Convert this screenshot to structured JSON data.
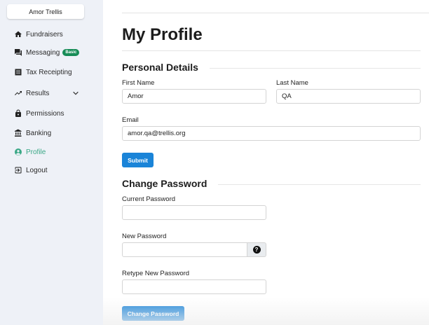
{
  "sidebar": {
    "org_name": "Amor Trellis",
    "items": [
      {
        "label": "Fundraisers",
        "icon": "home-icon"
      },
      {
        "label": "Messaging",
        "icon": "chat-icon",
        "badge": "Basic"
      },
      {
        "label": "Tax Receipting",
        "icon": "receipt-icon"
      },
      {
        "label": "Results",
        "icon": "trending-up-icon"
      },
      {
        "label": "Permissions",
        "icon": "lock-icon"
      },
      {
        "label": "Banking",
        "icon": "bank-icon"
      },
      {
        "label": "Profile",
        "icon": "user-circle-icon",
        "active": true
      },
      {
        "label": "Logout",
        "icon": "logout-icon"
      }
    ]
  },
  "main": {
    "title": "My Profile",
    "personal": {
      "heading": "Personal Details",
      "first_name_label": "First Name",
      "first_name_value": "Amor",
      "last_name_label": "Last Name",
      "last_name_value": "QA",
      "email_label": "Email",
      "email_value": "amor.qa@trellis.org",
      "submit_label": "Submit"
    },
    "password": {
      "heading": "Change Password",
      "current_label": "Current Password",
      "new_label": "New Password",
      "help_glyph": "?",
      "retype_label": "Retype New Password",
      "button_label": "Change Password"
    }
  },
  "colors": {
    "sidebar_bg": "#eef1f7",
    "accent_active": "#3aa886",
    "badge": "#178c57",
    "primary_button": "#1a84d8"
  }
}
